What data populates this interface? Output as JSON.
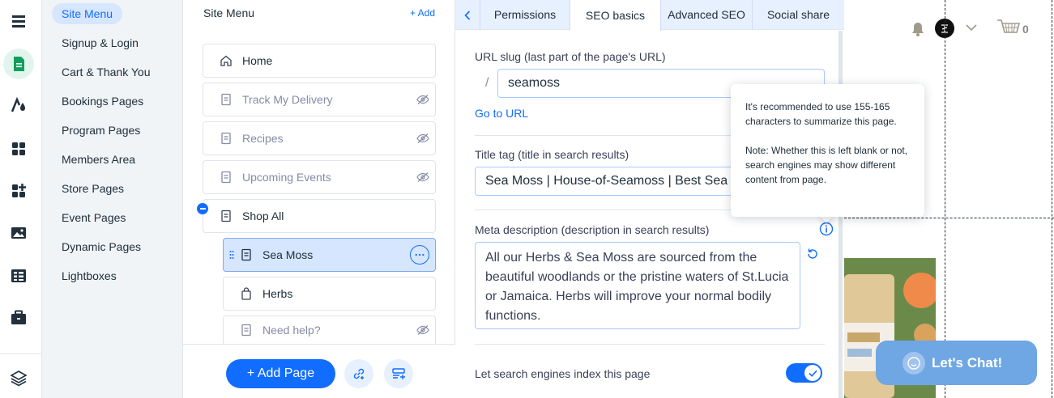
{
  "rail": {
    "icons": [
      "menu-icon",
      "pages-icon",
      "design-icon",
      "apps-icon",
      "add-apps-icon",
      "media-icon",
      "cms-icon",
      "business-icon",
      "layers-icon"
    ]
  },
  "categories": [
    {
      "label": "Site Menu",
      "active": true
    },
    {
      "label": "Signup & Login"
    },
    {
      "label": "Cart & Thank You"
    },
    {
      "label": "Bookings Pages"
    },
    {
      "label": "Program Pages"
    },
    {
      "label": "Members Area"
    },
    {
      "label": "Store Pages"
    },
    {
      "label": "Event Pages"
    },
    {
      "label": "Dynamic Pages"
    },
    {
      "label": "Lightboxes"
    }
  ],
  "pages_panel": {
    "title": "Site Menu",
    "add_label": "+ Add",
    "items": [
      {
        "label": "Home",
        "icon": "home-icon",
        "hidden": false
      },
      {
        "label": "Track My Delivery",
        "icon": "page-icon",
        "hidden": true
      },
      {
        "label": "Recipes",
        "icon": "page-icon",
        "hidden": true
      },
      {
        "label": "Upcoming Events",
        "icon": "page-icon",
        "hidden": true
      },
      {
        "label": "Shop All",
        "icon": "page-icon",
        "hidden": false
      },
      {
        "label": "Sea Moss",
        "icon": "page-icon",
        "hidden": false,
        "selected": true
      },
      {
        "label": "Herbs",
        "icon": "bag-icon",
        "hidden": false
      },
      {
        "label": "Need help?",
        "icon": "page-icon",
        "hidden": true
      }
    ],
    "add_page_label": "+ Add Page"
  },
  "settings": {
    "tabs": [
      {
        "label": "Permissions"
      },
      {
        "label": "SEO basics",
        "active": true
      },
      {
        "label": "Advanced SEO"
      },
      {
        "label": "Social share"
      }
    ],
    "url_slug_label": "URL slug (last part of the page's URL)",
    "url_prefix": "/",
    "url_slug_value": "seamoss",
    "go_to_url": "Go to URL",
    "title_tag_label": "Title tag (title in search results)",
    "title_tag_value": "Sea Moss | House-of-Seamoss | Best Sea Moss",
    "meta_label": "Meta description (description in search results)",
    "meta_value": "All our Herbs & Sea Moss are sourced from the beautiful woodlands or the pristine waters of St.Lucia or Jamaica. Herbs will improve your normal bodily functions.",
    "index_label": "Let search engines index this page",
    "index_enabled": true
  },
  "tooltip": {
    "line1": "It's recommended to use 155-165 characters to summarize this page.",
    "line2": "Note: Whether this is left blank or not, search engines may show different content from page."
  },
  "preview": {
    "cart_count": "0",
    "chat_label": "Let's Chat!",
    "accent": "#6fa6e4"
  },
  "colors": {
    "accent": "#116dff",
    "selected_bg": "#d6e6fe",
    "tab_bg": "#e7f0ff"
  }
}
